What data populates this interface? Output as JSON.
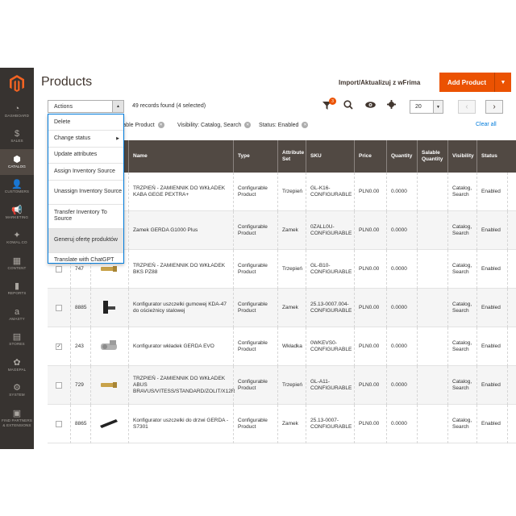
{
  "sidebar": {
    "items": [
      {
        "label": "DASHBOARD",
        "icon": "dashboard-icon",
        "glyph": "◔"
      },
      {
        "label": "SALES",
        "icon": "dollar-icon",
        "glyph": "$"
      },
      {
        "label": "CATALOG",
        "icon": "cube-icon",
        "glyph": "⬢"
      },
      {
        "label": "CUSTOMERS",
        "icon": "person-icon",
        "glyph": "👤"
      },
      {
        "label": "MARKETING",
        "icon": "megaphone-icon",
        "glyph": "📢"
      },
      {
        "label": "KOWAL.CO",
        "icon": "star-icon",
        "glyph": "✦"
      },
      {
        "label": "CONTENT",
        "icon": "content-icon",
        "glyph": "▦"
      },
      {
        "label": "REPORTS",
        "icon": "bar-chart-icon",
        "glyph": "▮"
      },
      {
        "label": "AMASTY",
        "icon": "amasty-icon",
        "glyph": "a"
      },
      {
        "label": "STORES",
        "icon": "store-icon",
        "glyph": "▤"
      },
      {
        "label": "MAGEPAL",
        "icon": "magepal-icon",
        "glyph": "✿"
      },
      {
        "label": "SYSTEM",
        "icon": "system-gear-icon",
        "glyph": "⚙"
      },
      {
        "label": "FIND PARTNERS & EXTENSIONS",
        "icon": "partners-icon",
        "glyph": "▣"
      }
    ]
  },
  "header": {
    "title": "Products",
    "import_label": "Import/Aktualizuj z wFrima",
    "add_label": "Add Product",
    "add_arrow": "▼"
  },
  "toolbar": {
    "actions_label": "Actions",
    "actions_arrow": "▲",
    "records": "49 records found (4 selected)",
    "filter_count": "3",
    "per_page": "20",
    "per_page_arrow": "▼",
    "prev": "‹",
    "next": "›"
  },
  "filters": {
    "chips": [
      "rable Product",
      "Visibility: Catalog, Search",
      "Status: Enabled"
    ],
    "clear_all": "Clear all"
  },
  "dropdown": {
    "items": [
      {
        "label": "Delete",
        "two_line": false,
        "has_sub": false,
        "highlight": false
      },
      {
        "label": "Change status",
        "two_line": false,
        "has_sub": true,
        "highlight": false
      },
      {
        "label": "Update attributes",
        "two_line": false,
        "has_sub": false,
        "highlight": false
      },
      {
        "label": "Assign Inventory Source",
        "two_line": false,
        "has_sub": false,
        "highlight": false
      },
      {
        "label": "Unassign Inventory Source",
        "two_line": true,
        "has_sub": false,
        "highlight": false
      },
      {
        "label": "Transfer Inventory To Source",
        "two_line": true,
        "has_sub": false,
        "highlight": false
      },
      {
        "label": "Generuj ofertę produktów",
        "two_line": true,
        "has_sub": false,
        "highlight": true
      },
      {
        "label": "Translate with ChatGPT",
        "two_line": false,
        "has_sub": false,
        "highlight": false
      }
    ]
  },
  "table": {
    "columns": [
      "Name",
      "Type",
      "Attribute Set",
      "SKU",
      "Price",
      "Quantity",
      "Salable Quantity",
      "Visibility",
      "Status"
    ],
    "rows": [
      {
        "checked": false,
        "id": "",
        "name": "TRZPIEŃ - ZAMIENNIK DO WKŁADEK KABA GEGE PEXTRA+",
        "type": "Configurable Product",
        "attr": "Trzepień",
        "sku": "GL-K16-CONFIGURABLE",
        "price": "PLN0.00",
        "qty": "0.0000",
        "vis": "Catalog, Search",
        "status": "Enabled",
        "thumb": "pin"
      },
      {
        "checked": false,
        "id": "",
        "name": "Zamek GERDA G1000 Plus",
        "type": "Configurable Product",
        "attr": "Zamek",
        "sku": "0ZALL0U-CONFIGURABLE",
        "price": "PLN0.00",
        "qty": "0.0000",
        "vis": "Catalog, Search",
        "status": "Enabled",
        "thumb": "lock"
      },
      {
        "checked": false,
        "id": "747",
        "name": "TRZPIEŃ - ZAMIENNIK DO WKŁADEK BKS PZ88",
        "type": "Configurable Product",
        "attr": "Trzepień",
        "sku": "GL-B10-CONFIGURABLE",
        "price": "PLN0.00",
        "qty": "0.0000",
        "vis": "Catalog, Search",
        "status": "Enabled",
        "thumb": "pin"
      },
      {
        "checked": false,
        "id": "8885",
        "name": "Konfigurator uszczelki gumowej KDA-47 do ościeżnicy stalowej",
        "type": "Configurable Product",
        "attr": "Zamek",
        "sku": "25.13-0007.004-CONFIGURABLE",
        "price": "PLN0.00",
        "qty": "0.0000",
        "vis": "Catalog, Search",
        "status": "Enabled",
        "thumb": "seal"
      },
      {
        "checked": true,
        "id": "243",
        "name": "Konfigurator wkładek GERDA EVO",
        "type": "Configurable Product",
        "attr": "Wkładka",
        "sku": "0WKEVS0-CONFIGURABLE",
        "price": "PLN0.00",
        "qty": "0.0000",
        "vis": "Catalog, Search",
        "status": "Enabled",
        "thumb": "cyl"
      },
      {
        "checked": false,
        "id": "729",
        "name": "TRZPIEŃ - ZAMIENNIK DO WKŁADEK ABUS BRAVUS/VITESS/STANDARD/ZOLIT/X12R",
        "type": "Configurable Product",
        "attr": "Trzepień",
        "sku": "GL-A11-CONFIGURABLE",
        "price": "PLN0.00",
        "qty": "0.0000",
        "vis": "Catalog, Search",
        "status": "Enabled",
        "thumb": "pin"
      },
      {
        "checked": false,
        "id": "8865",
        "name": "Konfigurator uszczelki do drzwi GERDA - S7301",
        "type": "Configurable Product",
        "attr": "Zamek",
        "sku": "25.13-0007-CONFIGURABLE",
        "price": "PLN0.00",
        "qty": "0.0000",
        "vis": "Catalog, Search",
        "status": "Enabled",
        "thumb": "seal2"
      }
    ]
  },
  "colors": {
    "sidebar": "#373330",
    "accent": "#eb5202",
    "header_row": "#514943",
    "link": "#007bdb"
  }
}
